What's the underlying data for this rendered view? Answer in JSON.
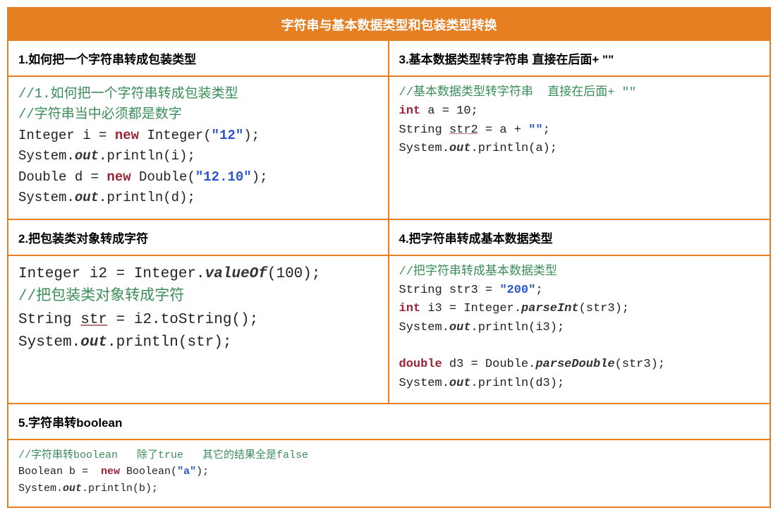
{
  "title": "字符串与基本数据类型和包装类型转换",
  "sections": {
    "s1": {
      "heading": "1.如何把一个字符串转成包装类型"
    },
    "s2": {
      "heading": "2.把包装类对象转成字符"
    },
    "s3": {
      "heading": "3.基本数据类型转字符串   直接在后面+ \"\""
    },
    "s4": {
      "heading": "4.把字符串转成基本数据类型"
    },
    "s5": {
      "heading": "5.字符串转boolean"
    }
  },
  "code": {
    "c1": {
      "cm1": "//1.如何把一个字符串转成包装类型",
      "cm2": "//字符串当中必须都是数字",
      "l1a": "Integer i = ",
      "l1b": "new",
      "l1c": " Integer(",
      "l1d": "\"12\"",
      "l1e": ");",
      "l2a": "System.",
      "l2b": "out",
      "l2c": ".println(i);",
      "l3a": "Double d = ",
      "l3b": "new",
      "l3c": " Double(",
      "l3d": "\"12.10\"",
      "l3e": ");",
      "l4a": "System.",
      "l4b": "out",
      "l4c": ".println(d);"
    },
    "c2": {
      "l1a": "Integer i2 = Integer.",
      "l1b": "valueOf",
      "l1c": "(100);",
      "cm1": "//把包装类对象转成字符",
      "l2a": "String ",
      "l2b": "str",
      "l2c": " = i2.toString();",
      "l3a": "System.",
      "l3b": "out",
      "l3c": ".println(str);"
    },
    "c3": {
      "cm1": "//基本数据类型转字符串  直接在后面+ \"\"",
      "l1a": "int",
      "l1b": " a = 10;",
      "l2a": "String ",
      "l2b": "str2",
      "l2c": " = a + ",
      "l2d": "\"\"",
      "l2e": ";",
      "l3a": "System.",
      "l3b": "out",
      "l3c": ".println(a);"
    },
    "c4": {
      "cm1": "//把字符串转成基本数据类型",
      "l1a": "String str3 = ",
      "l1b": "\"200\"",
      "l1c": ";",
      "l2a": "int",
      "l2b": " i3 = Integer.",
      "l2c": "parseInt",
      "l2d": "(str3);",
      "l3a": "System.",
      "l3b": "out",
      "l3c": ".println(i3);",
      "blank": " ",
      "l4a": "double",
      "l4b": " d3 = Double.",
      "l4c": "parseDouble",
      "l4d": "(str3);",
      "l5a": "System.",
      "l5b": "out",
      "l5c": ".println(d3);"
    },
    "c5": {
      "cm1": "//字符串转boolean   除了true   其它的结果全是false",
      "l1a": "Boolean b =  ",
      "l1b": "new",
      "l1c": " Boolean(",
      "l1d": "\"a\"",
      "l1e": ");",
      "l2a": "System.",
      "l2b": "out",
      "l2c": ".println(b);"
    }
  }
}
